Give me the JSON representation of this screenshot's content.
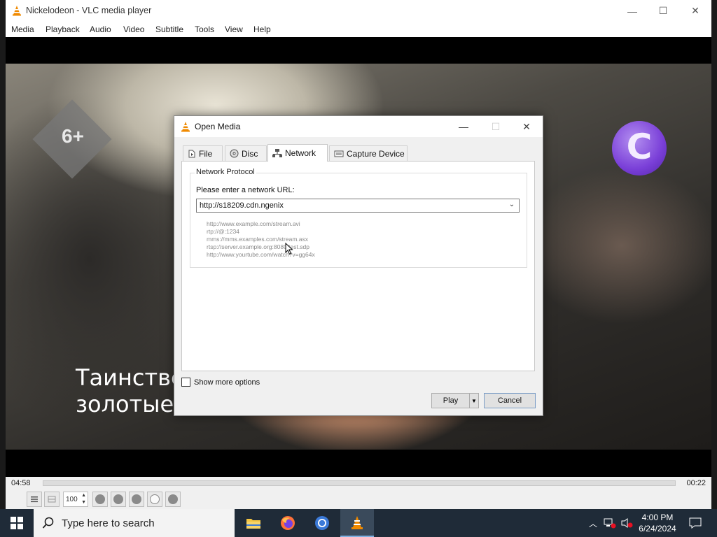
{
  "window": {
    "title": "Nickelodeon - VLC media player",
    "minimize_symbol": "—",
    "maximize_symbol": "☐",
    "close_symbol": "✕"
  },
  "menu": [
    "Media",
    "Playback",
    "Audio",
    "Video",
    "Subtitle",
    "Tools",
    "View",
    "Help"
  ],
  "video": {
    "age_rating": "6+",
    "channel_logo": "C",
    "subtitle_lines": [
      "Таинстве",
      "золотые"
    ]
  },
  "player": {
    "time_elapsed": "04:58",
    "time_remaining": "00:22",
    "zoom_value": "100"
  },
  "dialog": {
    "title": "Open Media",
    "tabs": [
      {
        "label": "File",
        "icon": "file-icon"
      },
      {
        "label": "Disc",
        "icon": "disc-icon"
      },
      {
        "label": "Network",
        "icon": "network-icon"
      },
      {
        "label": "Capture Device",
        "icon": "capture-device-icon"
      }
    ],
    "active_tab": "Network",
    "group_title": "Network Protocol",
    "url_label": "Please enter a network URL:",
    "url_value": "http://s18209.cdn.ngenix",
    "examples": [
      "http://www.example.com/stream.avi",
      "rtp://@:1234",
      "mms://mms.examples.com/stream.asx",
      "rtsp://server.example.org:8080/test.sdp",
      "http://www.yourtube.com/watch?v=gg64x"
    ],
    "show_more_options": "Show more options",
    "play_button": "Play",
    "cancel_button": "Cancel"
  },
  "taskbar": {
    "search_placeholder": "Type here to search",
    "time": "4:00 PM",
    "date": "6/24/2024",
    "apps": [
      "file-explorer-icon",
      "firefox-icon",
      "chrome-icon",
      "vlc-icon"
    ]
  },
  "colors": {
    "taskbar_bg": "#1f2b38",
    "vlc_orange": "#f08a00",
    "channel_purple": "#7a3fd8"
  }
}
